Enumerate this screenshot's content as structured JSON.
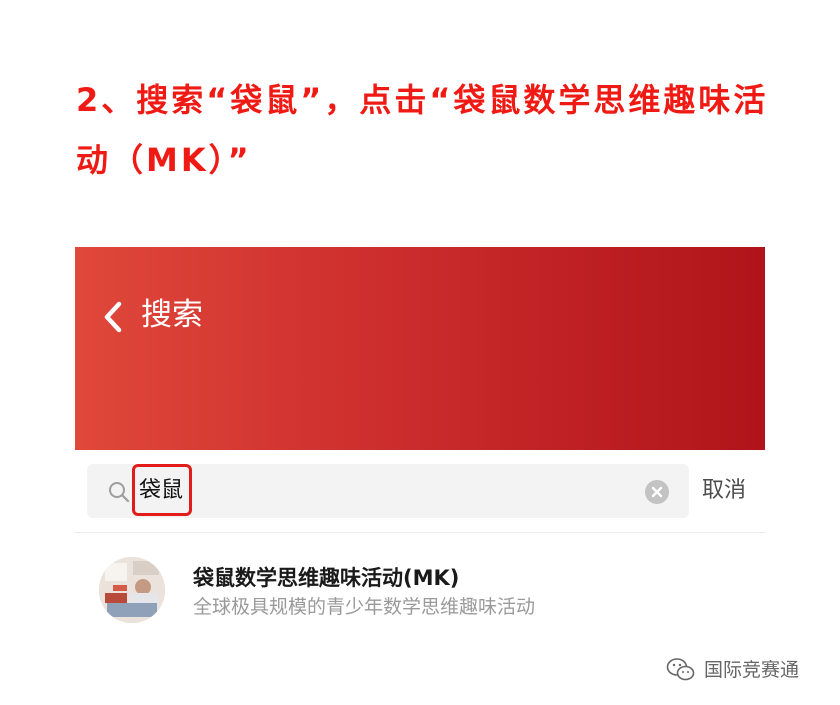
{
  "instruction": {
    "text": "2、搜索“袋鼠”，点击“袋鼠数学思维趣味活动（MK）”"
  },
  "header": {
    "back_icon": "chevron-left-icon",
    "title": "搜索",
    "accent_color": "#cc2d2d"
  },
  "search": {
    "value": "袋鼠",
    "search_icon": "search-icon",
    "clear_icon": "clear-icon",
    "cancel_label": "取消",
    "highlight_color": "#e41b1b"
  },
  "results": [
    {
      "title": "袋鼠数学思维趣味活动(MK)",
      "description": "全球极具规模的青少年数学思维趣味活动"
    }
  ],
  "watermark": {
    "icon": "wechat-icon",
    "text": "国际竞赛通"
  }
}
